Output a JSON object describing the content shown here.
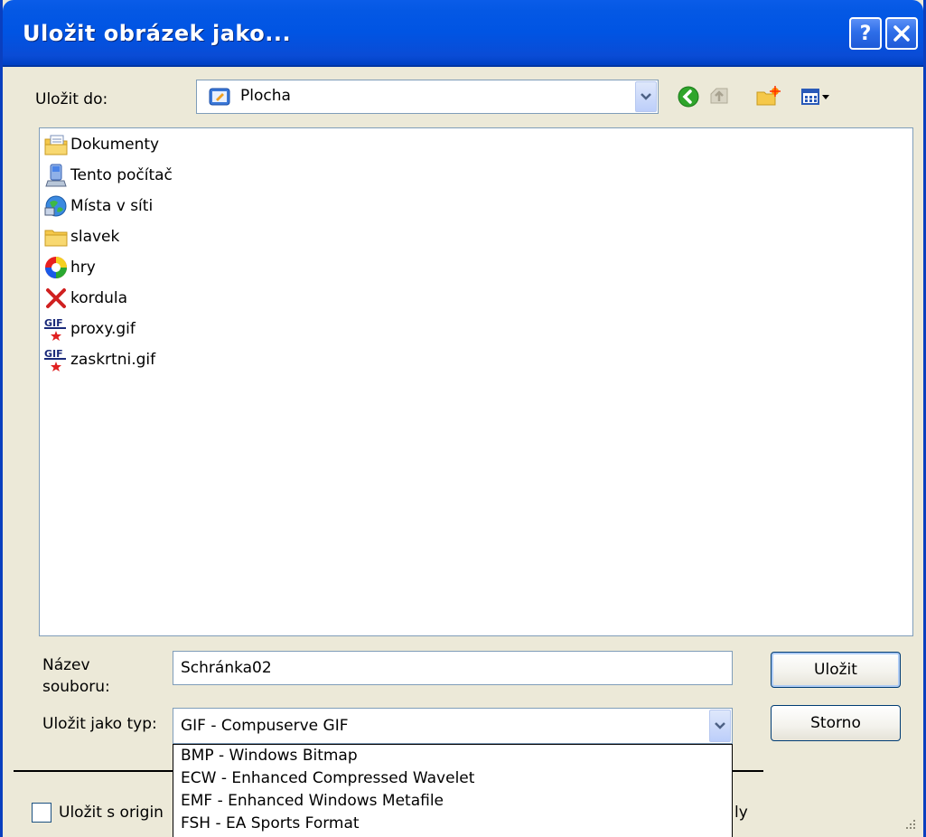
{
  "dialog": {
    "title": "Uložit obrázek jako...",
    "help_label": "?",
    "colors": {
      "titlebar": "#0054e3",
      "body": "#ece9d8"
    }
  },
  "location": {
    "label": "Uložit do:",
    "value": "Plocha",
    "toolbar_icons": [
      "back-arrow-icon",
      "up-folder-icon",
      "new-folder-icon",
      "view-menu-icon"
    ]
  },
  "files": [
    {
      "name": "Dokumenty",
      "icon": "documents-folder-icon"
    },
    {
      "name": "Tento počítač",
      "icon": "my-computer-icon"
    },
    {
      "name": "Místa v síti",
      "icon": "network-places-icon"
    },
    {
      "name": "slavek",
      "icon": "folder-icon"
    },
    {
      "name": "hry",
      "icon": "games-shortcut-icon"
    },
    {
      "name": "kordula",
      "icon": "broken-shortcut-icon"
    },
    {
      "name": "proxy.gif",
      "icon": "gif-file-icon"
    },
    {
      "name": "zaskrtni.gif",
      "icon": "gif-file-icon"
    }
  ],
  "filename": {
    "label_line1": "Název",
    "label_line2": "souboru:",
    "value": "Schránka02"
  },
  "filetype": {
    "label": "Uložit jako typ:",
    "value": "GIF - Compuserve GIF",
    "options": [
      "BMP - Windows Bitmap",
      "ECW - Enhanced Compressed Wavelet",
      "EMF - Enhanced Windows Metafile",
      "FSH - EA Sports Format"
    ]
  },
  "buttons": {
    "save": "Uložit",
    "cancel": "Storno"
  },
  "footer": {
    "checkbox_label": "Uložit s origin",
    "trailing_text": "ly"
  }
}
